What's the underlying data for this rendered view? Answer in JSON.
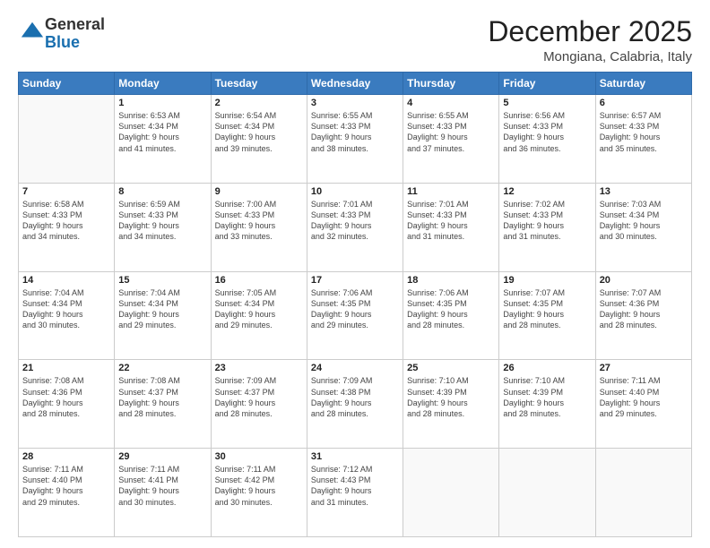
{
  "logo": {
    "general": "General",
    "blue": "Blue"
  },
  "header": {
    "month": "December 2025",
    "location": "Mongiana, Calabria, Italy"
  },
  "weekdays": [
    "Sunday",
    "Monday",
    "Tuesday",
    "Wednesday",
    "Thursday",
    "Friday",
    "Saturday"
  ],
  "weeks": [
    [
      {
        "day": "",
        "info": ""
      },
      {
        "day": "1",
        "info": "Sunrise: 6:53 AM\nSunset: 4:34 PM\nDaylight: 9 hours\nand 41 minutes."
      },
      {
        "day": "2",
        "info": "Sunrise: 6:54 AM\nSunset: 4:34 PM\nDaylight: 9 hours\nand 39 minutes."
      },
      {
        "day": "3",
        "info": "Sunrise: 6:55 AM\nSunset: 4:33 PM\nDaylight: 9 hours\nand 38 minutes."
      },
      {
        "day": "4",
        "info": "Sunrise: 6:55 AM\nSunset: 4:33 PM\nDaylight: 9 hours\nand 37 minutes."
      },
      {
        "day": "5",
        "info": "Sunrise: 6:56 AM\nSunset: 4:33 PM\nDaylight: 9 hours\nand 36 minutes."
      },
      {
        "day": "6",
        "info": "Sunrise: 6:57 AM\nSunset: 4:33 PM\nDaylight: 9 hours\nand 35 minutes."
      }
    ],
    [
      {
        "day": "7",
        "info": "Sunrise: 6:58 AM\nSunset: 4:33 PM\nDaylight: 9 hours\nand 34 minutes."
      },
      {
        "day": "8",
        "info": "Sunrise: 6:59 AM\nSunset: 4:33 PM\nDaylight: 9 hours\nand 34 minutes."
      },
      {
        "day": "9",
        "info": "Sunrise: 7:00 AM\nSunset: 4:33 PM\nDaylight: 9 hours\nand 33 minutes."
      },
      {
        "day": "10",
        "info": "Sunrise: 7:01 AM\nSunset: 4:33 PM\nDaylight: 9 hours\nand 32 minutes."
      },
      {
        "day": "11",
        "info": "Sunrise: 7:01 AM\nSunset: 4:33 PM\nDaylight: 9 hours\nand 31 minutes."
      },
      {
        "day": "12",
        "info": "Sunrise: 7:02 AM\nSunset: 4:33 PM\nDaylight: 9 hours\nand 31 minutes."
      },
      {
        "day": "13",
        "info": "Sunrise: 7:03 AM\nSunset: 4:34 PM\nDaylight: 9 hours\nand 30 minutes."
      }
    ],
    [
      {
        "day": "14",
        "info": "Sunrise: 7:04 AM\nSunset: 4:34 PM\nDaylight: 9 hours\nand 30 minutes."
      },
      {
        "day": "15",
        "info": "Sunrise: 7:04 AM\nSunset: 4:34 PM\nDaylight: 9 hours\nand 29 minutes."
      },
      {
        "day": "16",
        "info": "Sunrise: 7:05 AM\nSunset: 4:34 PM\nDaylight: 9 hours\nand 29 minutes."
      },
      {
        "day": "17",
        "info": "Sunrise: 7:06 AM\nSunset: 4:35 PM\nDaylight: 9 hours\nand 29 minutes."
      },
      {
        "day": "18",
        "info": "Sunrise: 7:06 AM\nSunset: 4:35 PM\nDaylight: 9 hours\nand 28 minutes."
      },
      {
        "day": "19",
        "info": "Sunrise: 7:07 AM\nSunset: 4:35 PM\nDaylight: 9 hours\nand 28 minutes."
      },
      {
        "day": "20",
        "info": "Sunrise: 7:07 AM\nSunset: 4:36 PM\nDaylight: 9 hours\nand 28 minutes."
      }
    ],
    [
      {
        "day": "21",
        "info": "Sunrise: 7:08 AM\nSunset: 4:36 PM\nDaylight: 9 hours\nand 28 minutes."
      },
      {
        "day": "22",
        "info": "Sunrise: 7:08 AM\nSunset: 4:37 PM\nDaylight: 9 hours\nand 28 minutes."
      },
      {
        "day": "23",
        "info": "Sunrise: 7:09 AM\nSunset: 4:37 PM\nDaylight: 9 hours\nand 28 minutes."
      },
      {
        "day": "24",
        "info": "Sunrise: 7:09 AM\nSunset: 4:38 PM\nDaylight: 9 hours\nand 28 minutes."
      },
      {
        "day": "25",
        "info": "Sunrise: 7:10 AM\nSunset: 4:39 PM\nDaylight: 9 hours\nand 28 minutes."
      },
      {
        "day": "26",
        "info": "Sunrise: 7:10 AM\nSunset: 4:39 PM\nDaylight: 9 hours\nand 28 minutes."
      },
      {
        "day": "27",
        "info": "Sunrise: 7:11 AM\nSunset: 4:40 PM\nDaylight: 9 hours\nand 29 minutes."
      }
    ],
    [
      {
        "day": "28",
        "info": "Sunrise: 7:11 AM\nSunset: 4:40 PM\nDaylight: 9 hours\nand 29 minutes."
      },
      {
        "day": "29",
        "info": "Sunrise: 7:11 AM\nSunset: 4:41 PM\nDaylight: 9 hours\nand 30 minutes."
      },
      {
        "day": "30",
        "info": "Sunrise: 7:11 AM\nSunset: 4:42 PM\nDaylight: 9 hours\nand 30 minutes."
      },
      {
        "day": "31",
        "info": "Sunrise: 7:12 AM\nSunset: 4:43 PM\nDaylight: 9 hours\nand 31 minutes."
      },
      {
        "day": "",
        "info": ""
      },
      {
        "day": "",
        "info": ""
      },
      {
        "day": "",
        "info": ""
      }
    ]
  ]
}
